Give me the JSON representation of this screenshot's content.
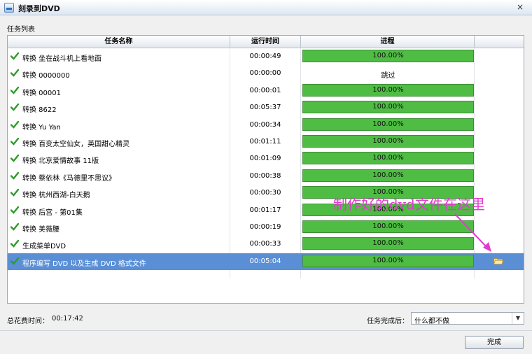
{
  "window": {
    "title": "刻录到DVD",
    "close_glyph": "×"
  },
  "section_label": "任务列表",
  "table": {
    "headers": {
      "name": "任务名称",
      "time": "运行时间",
      "progress": "进程"
    },
    "rows": [
      {
        "name": "转换 坐在战斗机上看地面",
        "time": "00:00:49",
        "progress": "100.00%",
        "progress_value": 1.0,
        "status": "done"
      },
      {
        "name": "转换 0000000",
        "time": "00:00:00",
        "progress": "跳过",
        "progress_value": 0,
        "status": "skipped"
      },
      {
        "name": "转换 00001",
        "time": "00:00:01",
        "progress": "100.00%",
        "progress_value": 1.0,
        "status": "done"
      },
      {
        "name": "转换 8622",
        "time": "00:05:37",
        "progress": "100.00%",
        "progress_value": 1.0,
        "status": "done"
      },
      {
        "name": "转换 Yu Yan",
        "time": "00:00:34",
        "progress": "100.00%",
        "progress_value": 1.0,
        "status": "done"
      },
      {
        "name": "转换 百变太空仙女，英国甜心精灵",
        "time": "00:01:11",
        "progress": "100.00%",
        "progress_value": 1.0,
        "status": "done"
      },
      {
        "name": "转换 北京爱情故事 11版",
        "time": "00:01:09",
        "progress": "100.00%",
        "progress_value": 1.0,
        "status": "done"
      },
      {
        "name": "转换 蔡依林《马德里不思议》",
        "time": "00:00:38",
        "progress": "100.00%",
        "progress_value": 1.0,
        "status": "done"
      },
      {
        "name": "转换 杭州西湖-白天鹅",
        "time": "00:00:30",
        "progress": "100.00%",
        "progress_value": 1.0,
        "status": "done"
      },
      {
        "name": "转换 后宫 - 第01集",
        "time": "00:01:17",
        "progress": "100.00%",
        "progress_value": 1.0,
        "status": "done"
      },
      {
        "name": "转换 美薇腰",
        "time": "00:00:19",
        "progress": "100.00%",
        "progress_value": 1.0,
        "status": "done"
      },
      {
        "name": "生成菜单DVD",
        "time": "00:00:33",
        "progress": "100.00%",
        "progress_value": 1.0,
        "status": "done"
      },
      {
        "name": "程序编写 DVD 以及生成 DVD 格式文件",
        "time": "00:05:04",
        "progress": "100.00%",
        "progress_value": 1.0,
        "status": "done",
        "selected": true,
        "icon": "folder-icon"
      }
    ]
  },
  "annotation": "制作好的dvd文件在这里",
  "footer": {
    "total_time_label": "总花费时间：",
    "total_time_value": "00:17:42",
    "after_complete_label": "任务完成后：",
    "after_complete_value": "什么都不做",
    "finish_label": "完成"
  },
  "colors": {
    "progress": "#4fbd44",
    "selected_row": "#5a8fd6",
    "annotation": "#e33ad1",
    "check": "#2f9a2a"
  }
}
